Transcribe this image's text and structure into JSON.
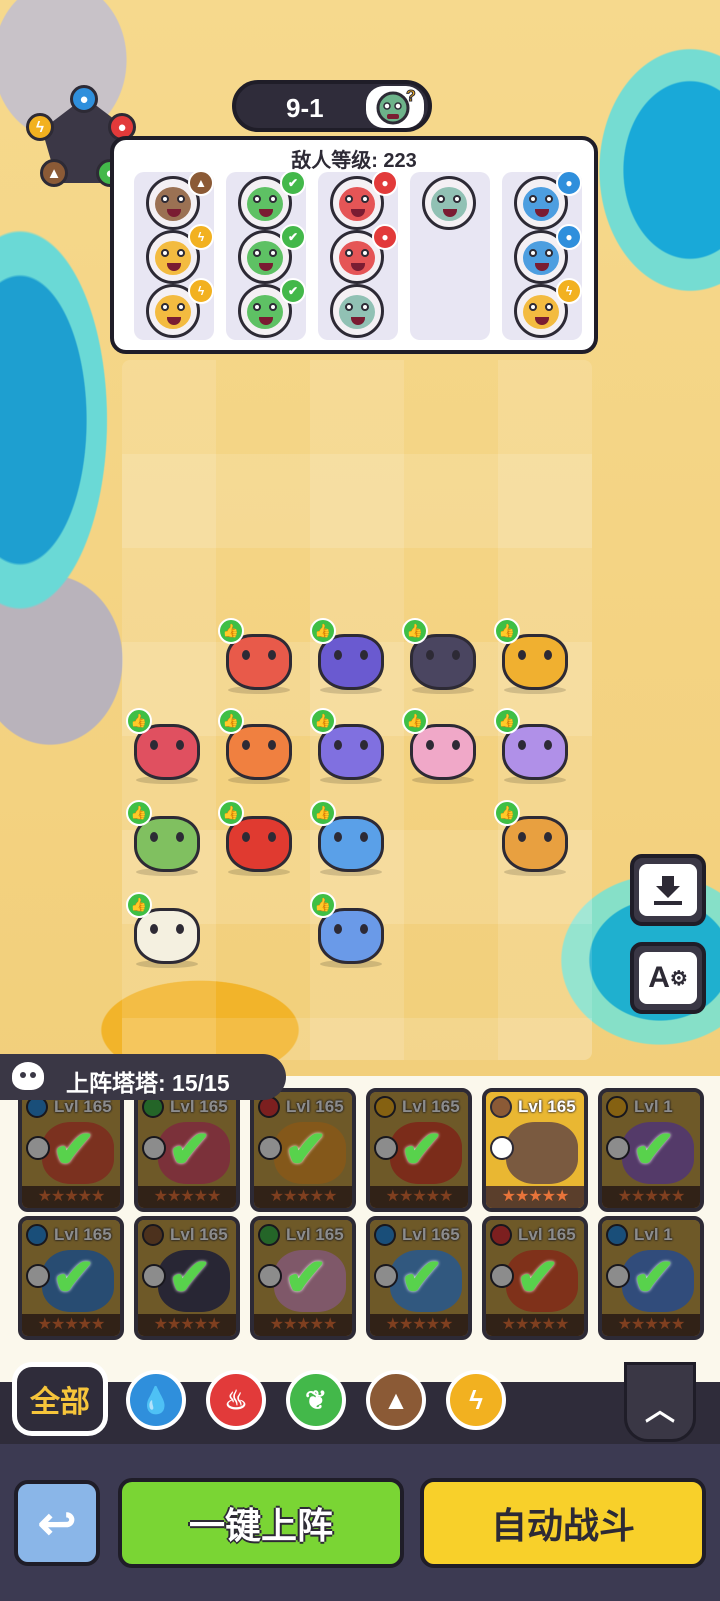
{
  "stage": {
    "label": "9-1",
    "boss_icon": "zombie-question-icon"
  },
  "enemy_panel": {
    "title": "敌人等级: 223",
    "columns": [
      {
        "enemies": [
          {
            "element": "earth"
          },
          {
            "element": "thunder"
          },
          {
            "element": "thunder"
          }
        ]
      },
      {
        "enemies": [
          {
            "element": "leaf"
          },
          {
            "element": "leaf"
          },
          {
            "element": "leaf"
          }
        ]
      },
      {
        "enemies": [
          {
            "element": "fire"
          },
          {
            "element": "fire"
          },
          {
            "element": "none"
          }
        ]
      },
      {
        "enemies": [
          {
            "element": "none"
          }
        ]
      },
      {
        "enemies": [
          {
            "element": "water"
          },
          {
            "element": "water"
          },
          {
            "element": "thunder"
          }
        ]
      }
    ]
  },
  "element_colors": {
    "water": "#2f8fdc",
    "fire": "#e23a3a",
    "leaf": "#43b84a",
    "earth": "#8b5a36",
    "thunder": "#f2b120",
    "none": "#7fb9a8"
  },
  "side_buttons": {
    "download_icon": "download-icon",
    "auto_settings_label": "A"
  },
  "roster": {
    "header": "上阵塔塔: 15/15",
    "cards_row1": [
      {
        "level": "Lvl 165",
        "element": "water",
        "color": "#e05a3a",
        "deployed": true
      },
      {
        "level": "Lvl 165",
        "element": "leaf",
        "color": "#e05a6a",
        "deployed": true
      },
      {
        "level": "Lvl 165",
        "element": "fire",
        "color": "#f0a030",
        "deployed": true
      },
      {
        "level": "Lvl 165",
        "element": "thunder",
        "color": "#e05030",
        "deployed": true
      },
      {
        "level": "Lvl 165",
        "element": "earth",
        "color": "#7a5a40",
        "deployed": false
      },
      {
        "level": "Lvl 1",
        "element": "thunder",
        "color": "#9a6ac0",
        "deployed": true
      }
    ],
    "cards_row2": [
      {
        "level": "Lvl 165",
        "element": "water",
        "color": "#4a8ad0",
        "deployed": true
      },
      {
        "level": "Lvl 165",
        "element": "earth",
        "color": "#4a4560",
        "deployed": true
      },
      {
        "level": "Lvl 165",
        "element": "leaf",
        "color": "#e8a0c0",
        "deployed": true
      },
      {
        "level": "Lvl 165",
        "element": "water",
        "color": "#5aa0e8",
        "deployed": true
      },
      {
        "level": "Lvl 165",
        "element": "fire",
        "color": "#e85a30",
        "deployed": true
      },
      {
        "level": "Lvl 1",
        "element": "water",
        "color": "#5a8ae0",
        "deployed": true
      }
    ],
    "stars": "★★★★★"
  },
  "filters": {
    "all_label": "全部",
    "icons": [
      {
        "name": "water",
        "glyph": "💧"
      },
      {
        "name": "fire",
        "glyph": "♨"
      },
      {
        "name": "leaf",
        "glyph": "❦"
      },
      {
        "name": "earth",
        "glyph": "▲"
      },
      {
        "name": "thunder",
        "glyph": "ϟ"
      }
    ],
    "collapse_glyph": "︿"
  },
  "actions": {
    "back_glyph": "↩",
    "deploy_label": "一键上阵",
    "auto_battle_label": "自动战斗"
  },
  "field_pets": [
    {
      "color": "#e85a4a"
    },
    {
      "color": "#6a5ad0"
    },
    {
      "color": "#4a4560"
    },
    {
      "color": "#f0b030"
    },
    {
      "color": "#e05060"
    },
    {
      "color": "#f08040"
    },
    {
      "color": "#8070e0"
    },
    {
      "color": "#f0a8c8"
    },
    {
      "color": "#b090e8"
    },
    {
      "color": "#80c060"
    },
    {
      "color": "#e03a30"
    },
    {
      "color": "#5aa0e8"
    },
    {
      "color": "#e8a040"
    },
    {
      "color": "#f4f0e0"
    },
    {
      "color": "#6a9ae8"
    }
  ]
}
